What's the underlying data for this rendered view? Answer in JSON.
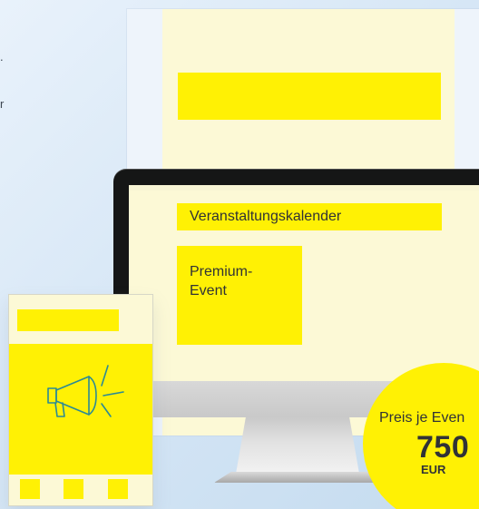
{
  "side_text": {
    "line1": ".",
    "line2": "r"
  },
  "screen": {
    "calendar_label": "Veranstaltungskalender",
    "premium_event_line1": "Premium-",
    "premium_event_line2": "Event"
  },
  "phone": {
    "icon": "megaphone-icon"
  },
  "price_badge": {
    "caption": "Preis je Even",
    "amount": "750",
    "currency": "EUR"
  },
  "colors": {
    "background_start": "#e9f2fb",
    "background_end": "#c4dbef",
    "yellow": "#fff104",
    "pale_yellow": "#fcf9d6",
    "dark_text": "#303236",
    "monitor_black": "#151616",
    "icon_teal": "#2b8a95"
  }
}
